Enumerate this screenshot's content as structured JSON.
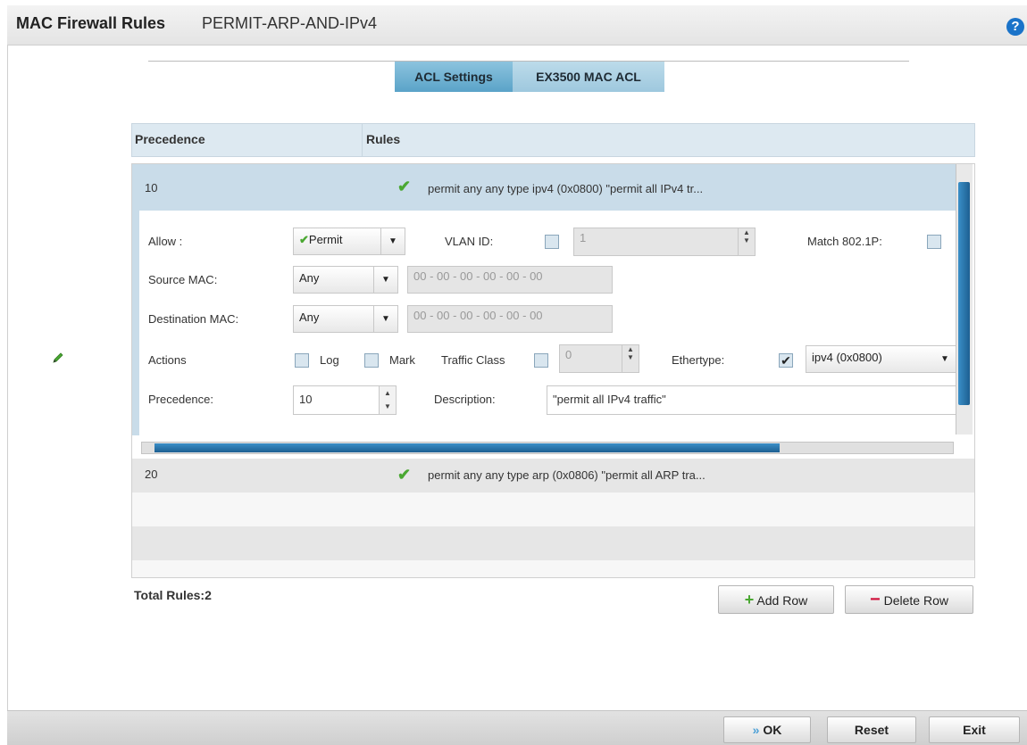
{
  "header": {
    "title": "MAC Firewall Rules",
    "subtitle": "PERMIT-ARP-AND-IPv4",
    "help": "?"
  },
  "tabs": [
    {
      "label": "ACL Settings",
      "active": true
    },
    {
      "label": "EX3500 MAC ACL",
      "active": false
    }
  ],
  "table": {
    "columns": [
      "Precedence",
      "Rules"
    ],
    "rows": [
      {
        "precedence": "10",
        "rule": "permit any any type ipv4 (0x0800) \"permit all IPv4 tr..."
      },
      {
        "precedence": "20",
        "rule": "permit any any type arp (0x0806) \"permit all ARP tra..."
      }
    ]
  },
  "editor": {
    "allow_label": "Allow :",
    "allow_value": "Permit",
    "vlan_label": "VLAN ID:",
    "vlan_value": "1",
    "match_label": "Match 802.1P:",
    "source_label": "Source MAC:",
    "source_value": "Any",
    "source_mac": "00 - 00 - 00 - 00 - 00 - 00",
    "dest_label": "Destination MAC:",
    "dest_value": "Any",
    "dest_mac": "00 - 00 - 00 - 00 - 00 - 00",
    "actions_label": "Actions",
    "log_label": "Log",
    "mark_label": "Mark",
    "traffic_label": "Traffic Class",
    "traffic_value": "0",
    "ethertype_label": "Ethertype:",
    "ethertype_value": "ipv4 (0x0800)",
    "precedence_label": "Precedence:",
    "precedence_value": "10",
    "description_label": "Description:",
    "description_value": "\"permit all IPv4 traffic\""
  },
  "footer": {
    "total": "Total Rules:2",
    "add_row": "Add Row",
    "delete_row": "Delete Row"
  },
  "bottom": {
    "ok": "OK",
    "reset": "Reset",
    "exit": "Exit"
  },
  "colors": {
    "accent": "#1d5f91",
    "check": "#4aa832",
    "delete": "#d0103a"
  },
  "icons": [
    "help-icon",
    "edit-pencil-icon",
    "check-icon",
    "plus-icon",
    "minus-icon",
    "ok-arrow-icon"
  ]
}
